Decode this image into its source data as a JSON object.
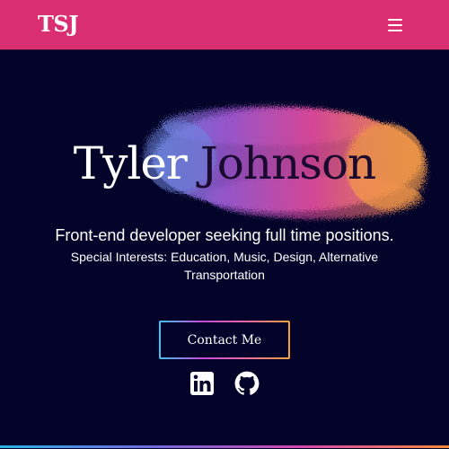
{
  "navbar": {
    "logo": "TSJ",
    "menu_icon": "hamburger-menu-icon",
    "background": "#d92f72"
  },
  "hero": {
    "first_name": "Tyler",
    "last_name": "Johnson",
    "tagline": "Front-end developer seeking full time positions.",
    "interests": "Special Interests: Education, Music, Design, Alternative Transportation",
    "background": "#04042a"
  },
  "actions": {
    "contact_label": "Contact Me"
  },
  "social": [
    {
      "icon": "linkedin-icon"
    },
    {
      "icon": "github-icon"
    }
  ]
}
